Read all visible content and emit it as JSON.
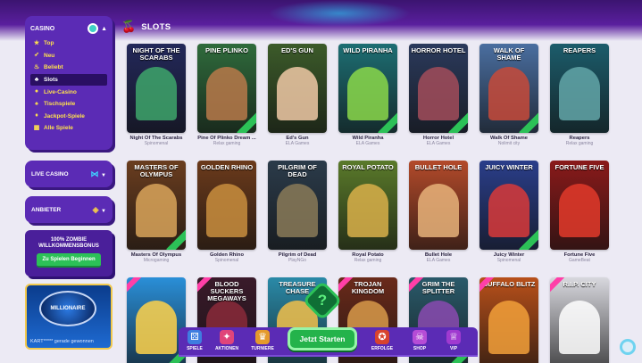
{
  "section": {
    "title": "SLOTS",
    "icon": "cherry-icon"
  },
  "sidebar": {
    "casino": {
      "title": "CASINO",
      "items": [
        {
          "label": "Top",
          "icon": "star-icon"
        },
        {
          "label": "Neu",
          "icon": "rocket-icon"
        },
        {
          "label": "Beliebt",
          "icon": "fire-icon"
        },
        {
          "label": "Slots",
          "icon": "cherry-icon",
          "active": true
        },
        {
          "label": "Live-Casino",
          "icon": "live-icon"
        },
        {
          "label": "Tischspiele",
          "icon": "table-icon"
        },
        {
          "label": "Jackpot-Spiele",
          "icon": "jackpot-icon"
        },
        {
          "label": "Alle Spiele",
          "icon": "grid-icon"
        }
      ]
    },
    "live_casino": {
      "label": "LIVE CASINO"
    },
    "providers": {
      "label": "ANBIETER"
    },
    "bonus": {
      "line1": "100% ZOMBIE",
      "line2": "WILLKOMMENSBONUS",
      "button": "Zu Spielen Beginnen"
    },
    "promo": {
      "logo_text": "MILLIONAIRE",
      "winner_text": "KART***** gerade gewonnen"
    }
  },
  "games": [
    {
      "title": "NIGHT OF THE SCARABS",
      "name": "Night Of The Scarabs",
      "provider": "Spinomenal",
      "bg": "#23285a",
      "art": "#3ea66b"
    },
    {
      "title": "PINE PLINKO",
      "name": "Pine Of Plinko Dream ...",
      "provider": "Relax gaming",
      "bg": "#2f6b3c",
      "art": "#b9794a"
    },
    {
      "title": "ED'S GUN",
      "name": "Ed's Gun",
      "provider": "ELA Games",
      "bg": "#3c5b2a",
      "art": "#f0c9a6"
    },
    {
      "title": "WILD PIRANHA",
      "name": "Wild Piranha",
      "provider": "ELA Games",
      "bg": "#1d6e73",
      "art": "#8bd84a"
    },
    {
      "title": "HORROR HOTEL",
      "name": "Horror Hotel",
      "provider": "ELA Games",
      "bg": "#2b3a5c",
      "art": "#a24c5b"
    },
    {
      "title": "WALK OF SHAME",
      "name": "Walk Of Shame",
      "provider": "Nolimit city",
      "bg": "#4a6ea0",
      "art": "#c74a3a"
    },
    {
      "title": "REAPERS",
      "name": "Reapers",
      "provider": "Relax gaming",
      "bg": "#1c5c6b",
      "art": "#63a6a8"
    },
    {
      "title": "MASTERS OF OLYMPUS",
      "name": "Masters Of Olympus",
      "provider": "Microgaming",
      "bg": "#6a3d1f",
      "art": "#d9a45a"
    },
    {
      "title": "GOLDEN RHINO",
      "name": "Golden Rhino",
      "provider": "Spinomenal",
      "bg": "#6b3a1b",
      "art": "#c98e3e"
    },
    {
      "title": "PILGRIM OF DEAD",
      "name": "Pilgrim of Dead",
      "provider": "PlayNGo",
      "bg": "#2b3b4a",
      "art": "#8a7a58"
    },
    {
      "title": "ROYAL POTATO",
      "name": "Royal Potato",
      "provider": "Relax gaming",
      "bg": "#5a7a2a",
      "art": "#d9b04a"
    },
    {
      "title": "BULLET HOLE",
      "name": "Bullet Hole",
      "provider": "ELA Games",
      "bg": "#b34a2a",
      "art": "#e8b37a"
    },
    {
      "title": "JUICY WINTER",
      "name": "Juicy Winter",
      "provider": "Spinomenal",
      "bg": "#2a3e8a",
      "art": "#d83a3a"
    },
    {
      "title": "FORTUNE FIVE",
      "name": "Fortune Five",
      "provider": "GameBeat",
      "bg": "#8a1a1a",
      "art": "#e23a2a"
    },
    {
      "title": "",
      "name": "",
      "provider": "",
      "bg": "#2a8fd8",
      "art": "#ffd24a"
    },
    {
      "title": "BLOOD SUCKERS MEGAWAYS",
      "name": "",
      "provider": "",
      "bg": "#3a1a2a",
      "art": "#8a2a3a"
    },
    {
      "title": "TREASURE CHASE",
      "name": "",
      "provider": "",
      "bg": "#2a8aa8",
      "art": "#f2c04a"
    },
    {
      "title": "TROJAN KINGDOM",
      "name": "",
      "provider": "",
      "bg": "#6a2a1a",
      "art": "#d89a4a"
    },
    {
      "title": "GRIM THE SPLITTER",
      "name": "",
      "provider": "",
      "bg": "#2a5a6a",
      "art": "#8a4ab0"
    },
    {
      "title": "BUFFALO BLITZ",
      "name": "",
      "provider": "",
      "bg": "#b8501a",
      "art": "#f2a03a"
    },
    {
      "title": "R.I.P. CITY",
      "name": "",
      "provider": "",
      "bg": "#d8d8de",
      "art": "#ffffff"
    }
  ],
  "bottom_nav": {
    "items": [
      {
        "label": "SPIELE",
        "icon": "dice-icon"
      },
      {
        "label": "AKTIONEN",
        "icon": "gift-icon"
      },
      {
        "label": "TURNIERE",
        "icon": "trophy-icon"
      },
      {
        "label": "ERFOLGE",
        "icon": "achievement-icon"
      },
      {
        "label": "SHOP",
        "icon": "shop-icon"
      },
      {
        "label": "VIP",
        "icon": "vip-icon"
      }
    ],
    "start_button": "Jetzt Starten",
    "center_icon": "question-icon"
  }
}
